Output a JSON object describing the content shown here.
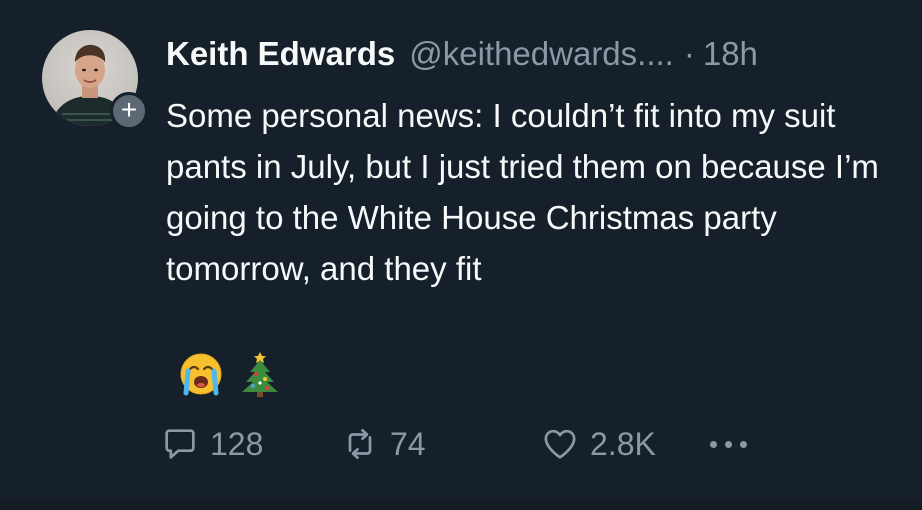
{
  "tweet": {
    "author_name": "Keith Edwards",
    "author_handle": "@keithedwards....",
    "separator": "·",
    "time_ago": "18h",
    "body": "Some personal news: I couldn’t fit into my suit pants in July, but I just tried them on because I’m going to the White House Christmas party tomorrow, and they fit",
    "emojis": [
      "loudly-crying-face",
      "christmas-tree"
    ],
    "follow_badge": "+",
    "stats": {
      "replies": "128",
      "retweets": "74",
      "likes": "2.8K"
    }
  },
  "colors": {
    "background": "#15202b",
    "text_primary": "#f7f9f9",
    "text_secondary": "#8b98a5"
  }
}
